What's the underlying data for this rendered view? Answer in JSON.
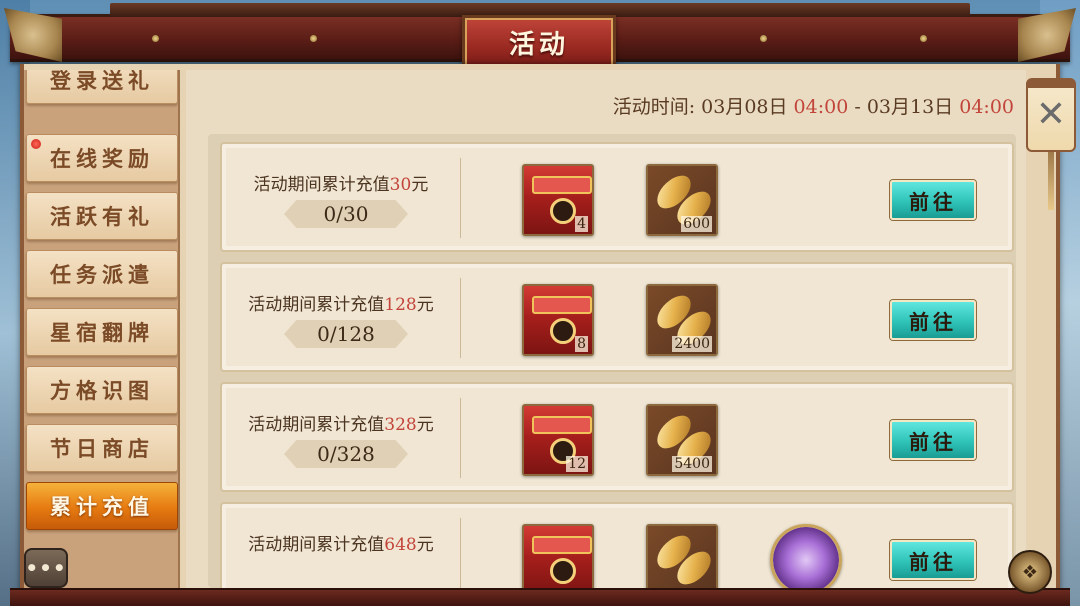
{
  "window": {
    "title": "活动"
  },
  "sidebar": {
    "items": [
      {
        "label": "登录送礼",
        "active": false,
        "badge": false
      },
      {
        "label": "在线奖励",
        "active": false,
        "badge": true
      },
      {
        "label": "活跃有礼",
        "active": false,
        "badge": false
      },
      {
        "label": "任务派遣",
        "active": false,
        "badge": false
      },
      {
        "label": "星宿翻牌",
        "active": false,
        "badge": false
      },
      {
        "label": "方格识图",
        "active": false,
        "badge": false
      },
      {
        "label": "节日商店",
        "active": false,
        "badge": false
      },
      {
        "label": "累计充值",
        "active": true,
        "badge": false
      }
    ],
    "chat_icon": "chat-bubble-icon",
    "chat_glyph": "•••"
  },
  "event_time": {
    "label": "活动时间:",
    "start_date": "03月08日",
    "start_time": "04:00",
    "separator": "-",
    "end_date": "03月13日",
    "end_time": "04:00"
  },
  "rows": [
    {
      "desc_prefix": "活动期间累计充值",
      "amount": "30",
      "unit": "元",
      "progress": "0/30",
      "rewards": [
        {
          "icon": "red-chest-icon",
          "qty": "4"
        },
        {
          "icon": "golden-seed-icon",
          "qty": "600"
        }
      ],
      "button": "前往"
    },
    {
      "desc_prefix": "活动期间累计充值",
      "amount": "128",
      "unit": "元",
      "progress": "0/128",
      "rewards": [
        {
          "icon": "red-chest-icon",
          "qty": "8"
        },
        {
          "icon": "golden-seed-icon",
          "qty": "2400"
        }
      ],
      "button": "前往"
    },
    {
      "desc_prefix": "活动期间累计充值",
      "amount": "328",
      "unit": "元",
      "progress": "0/328",
      "rewards": [
        {
          "icon": "red-chest-icon",
          "qty": "12"
        },
        {
          "icon": "golden-seed-icon",
          "qty": "5400"
        }
      ],
      "button": "前往"
    },
    {
      "desc_prefix": "活动期间累计充值",
      "amount": "648",
      "unit": "元",
      "progress": "",
      "rewards": [
        {
          "icon": "red-chest-icon",
          "qty": ""
        },
        {
          "icon": "golden-seed-icon",
          "qty": ""
        },
        {
          "icon": "purple-orb-icon",
          "qty": ""
        }
      ],
      "button": "前往"
    }
  ],
  "close_glyph": "✕",
  "corner_glyph": "❖",
  "colors": {
    "accent_red": "#c2443a",
    "go_button": "#2fc3b8",
    "active_tab": "#e67a10",
    "title_plaque": "#9b2a22"
  }
}
